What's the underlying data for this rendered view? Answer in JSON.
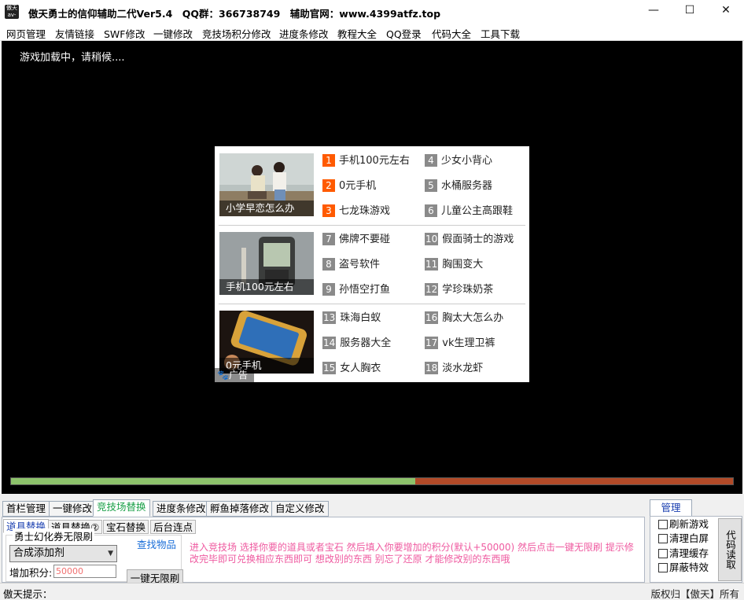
{
  "window": {
    "icon_text": "傲天\nav-tian",
    "title": "傲天勇士的信仰辅助二代Ver5.4　QQ群：366738749　辅助官网：www.4399atfz.top",
    "minimize": "—",
    "maximize": "☐",
    "close": "✕"
  },
  "menu": [
    "网页管理",
    "友情链接",
    "SWF修改",
    "一键修改",
    "竞技场积分修改",
    "进度条修改",
    "教程大全",
    "QQ登录",
    "代码大全",
    "工具下载"
  ],
  "game": {
    "loading_text": "游戏加载中，请稍候....",
    "ad": {
      "badge": "广告",
      "rows": [
        {
          "caption": "小学早恋怎么办",
          "links": [
            {
              "n": "1",
              "text": "手机100元左右",
              "hot": true
            },
            {
              "n": "4",
              "text": "少女小背心",
              "hot": false
            },
            {
              "n": "2",
              "text": "0元手机",
              "hot": true
            },
            {
              "n": "5",
              "text": "水桶服务器",
              "hot": false
            },
            {
              "n": "3",
              "text": "七龙珠游戏",
              "hot": true
            },
            {
              "n": "6",
              "text": "儿童公主高跟鞋",
              "hot": false
            }
          ]
        },
        {
          "caption": "手机100元左右",
          "links": [
            {
              "n": "7",
              "text": "佛牌不要碰",
              "hot": false
            },
            {
              "n": "10",
              "text": "假面骑士的游戏",
              "hot": false
            },
            {
              "n": "8",
              "text": "盗号软件",
              "hot": false
            },
            {
              "n": "11",
              "text": "胸围变大",
              "hot": false
            },
            {
              "n": "9",
              "text": "孙悟空打鱼",
              "hot": false
            },
            {
              "n": "12",
              "text": "学珍珠奶茶",
              "hot": false
            }
          ]
        },
        {
          "caption": "0元手机",
          "links": [
            {
              "n": "13",
              "text": "珠海白蚁",
              "hot": false
            },
            {
              "n": "16",
              "text": "胸太大怎么办",
              "hot": false
            },
            {
              "n": "14",
              "text": "服务器大全",
              "hot": false
            },
            {
              "n": "17",
              "text": "vk生理卫裤",
              "hot": false
            },
            {
              "n": "15",
              "text": "女人胸衣",
              "hot": false
            },
            {
              "n": "18",
              "text": "淡水龙虾",
              "hot": false
            }
          ]
        }
      ]
    },
    "progress": 0.56,
    "colors": {
      "progress_fill": "#8dc26b",
      "progress_track": "#b24a28",
      "hot": "#ff5a00"
    }
  },
  "tabs": [
    {
      "label": "首栏管理",
      "active": false
    },
    {
      "label": "一键修改",
      "active": false
    },
    {
      "label": "竞技场替换",
      "active": true
    },
    {
      "label": "进度条修改",
      "active": false
    },
    {
      "label": "孵鱼掉落修改",
      "active": false
    },
    {
      "label": "自定义修改",
      "active": false
    }
  ],
  "subtabs": [
    {
      "label": "道具替换",
      "active": true
    },
    {
      "label": "道具替换②",
      "active": false
    },
    {
      "label": "宝石替换",
      "active": false
    },
    {
      "label": "后台连点",
      "active": false
    }
  ],
  "item_panel": {
    "group_title": "勇士幻化券无限刷",
    "find_link": "查找物品",
    "combo_value": "合成添加剂",
    "score_label": "增加积分:",
    "score_placeholder": "50000",
    "button": "一键无限刷",
    "hint": "进入竞技场 选择你要的道具或者宝石 然后填入你要增加的积分(默认+50000) 然后点击一键无限刷 提示修改完毕即可兑换相应东西即可 想改别的东西 别忘了还原 才能修改别的东西哦"
  },
  "manage": {
    "tab": "管理",
    "checkboxes": [
      "刷新游戏",
      "清理白屏",
      "清理缓存",
      "屏蔽特效"
    ],
    "vertical_button": "代码读取"
  },
  "status": {
    "label": "傲天提示：",
    "right": "版权归【傲天】所有"
  }
}
